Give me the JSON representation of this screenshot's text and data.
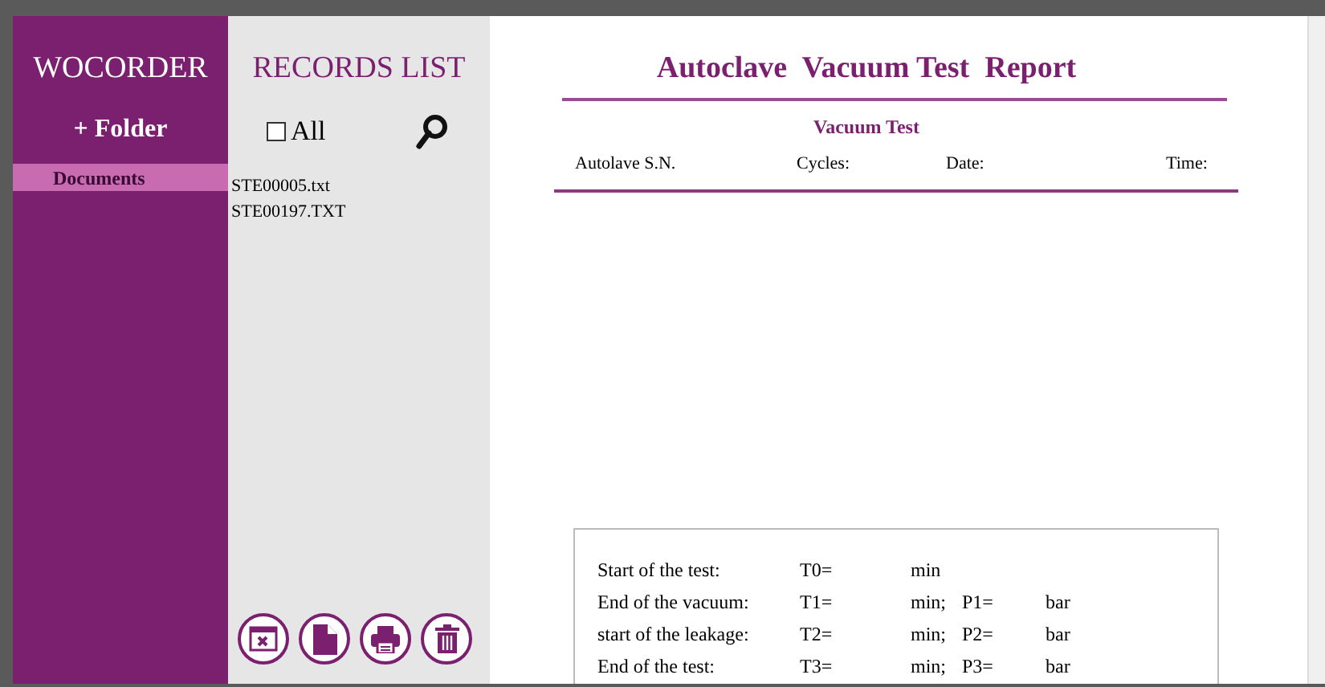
{
  "sidebar": {
    "title": "WOCORDER",
    "add_button": "+ Folder",
    "items": [
      {
        "label": "Documents",
        "selected": true
      }
    ]
  },
  "records": {
    "title": "RECORDS LIST",
    "select_all": {
      "label": "All",
      "checked": false
    },
    "files": [
      {
        "name": "STE00005.txt",
        "selected": false
      },
      {
        "name": "STE00197.TXT",
        "selected": false
      }
    ]
  },
  "report": {
    "title": "Autoclave  Vacuum Test  Report",
    "subtitle": "Vacuum Test",
    "header_fields": [
      "Autolave S.N.",
      "Cycles:",
      "Date:",
      "Time:"
    ],
    "readings": [
      {
        "label": "Start of the test:",
        "time": "T0=",
        "time_unit": "min"
      },
      {
        "label": "End of the vacuum:",
        "time": "T1=",
        "time_unit": "min;",
        "pressure": "P1=",
        "pressure_unit": "bar"
      },
      {
        "label": "start of the leakage:",
        "time": "T2=",
        "time_unit": "min;",
        "pressure": "P2=",
        "pressure_unit": "bar"
      },
      {
        "label": "End of the test:",
        "time": "T3=",
        "time_unit": "min;",
        "pressure": "P3=",
        "pressure_unit": "bar"
      }
    ]
  }
}
